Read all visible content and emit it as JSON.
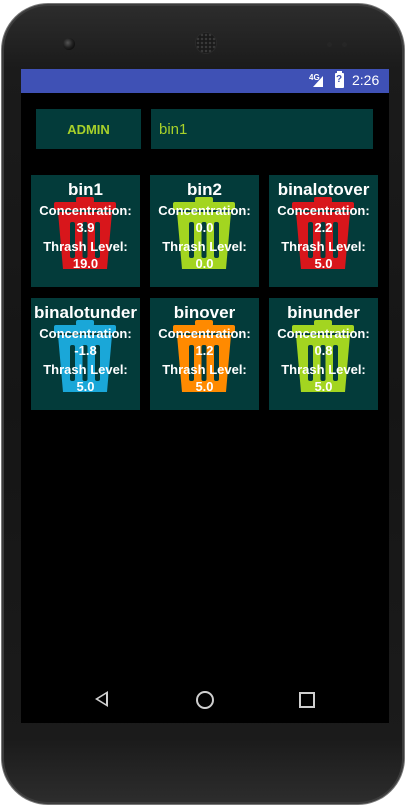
{
  "status_bar": {
    "network": "4G",
    "time": "2:26"
  },
  "top_controls": {
    "admin_label": "ADMIN",
    "bin_input_value": "bin1"
  },
  "bins": [
    {
      "name": "bin1",
      "concentration_label": "Concentration:",
      "concentration": "3.9",
      "level_label": "Thrash Level:",
      "level": "19.0",
      "color": "#d8161b"
    },
    {
      "name": "bin2",
      "concentration_label": "Concentration:",
      "concentration": "0.0",
      "level_label": "Thrash Level:",
      "level": "0.0",
      "color": "#a3d520"
    },
    {
      "name": "binalotover",
      "concentration_label": "Concentration:",
      "concentration": "2.2",
      "level_label": "Thrash Level:",
      "level": "5.0",
      "color": "#d8161b"
    },
    {
      "name": "binalotunder",
      "concentration_label": "Concentration:",
      "concentration": "-1.8",
      "level_label": "Thrash Level:",
      "level": "5.0",
      "color": "#1aa7d8"
    },
    {
      "name": "binover",
      "concentration_label": "Concentration:",
      "concentration": "1.2",
      "level_label": "Thrash Level:",
      "level": "5.0",
      "color": "#ff8a00"
    },
    {
      "name": "binunder",
      "concentration_label": "Concentration:",
      "concentration": "0.8",
      "level_label": "Thrash Level:",
      "level": "5.0",
      "color": "#a3d520"
    }
  ]
}
